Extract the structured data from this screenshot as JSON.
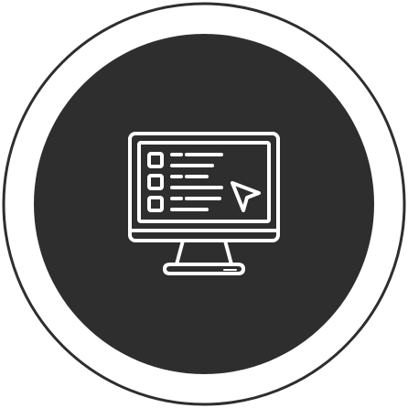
{
  "icon": {
    "name": "computer-monitor-checklist-cursor-icon",
    "colors": {
      "background": "#ffffff",
      "outer_ring": "#2e2e2e",
      "disc": "#2e2e2e",
      "line_art": "#ffffff"
    }
  }
}
